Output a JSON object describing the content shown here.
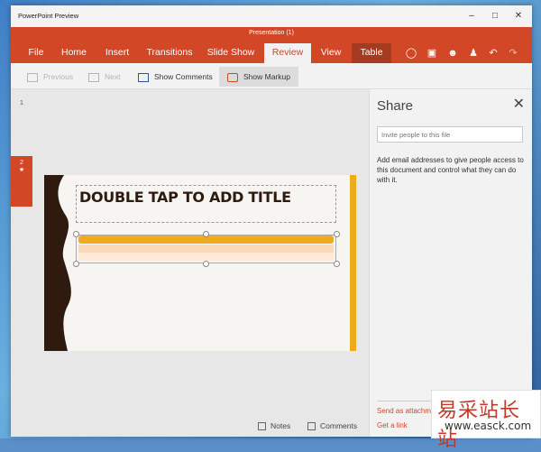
{
  "window": {
    "app_title": "PowerPoint Preview",
    "doc_title": "Presentation (1)"
  },
  "ribbon": {
    "tabs": [
      "File",
      "Home",
      "Insert",
      "Transitions",
      "Slide Show",
      "Review",
      "View",
      "Table"
    ],
    "active_tab": "Review",
    "accent_color": "#d24726"
  },
  "toolbar": {
    "previous": "Previous",
    "next": "Next",
    "show_comments": "Show Comments",
    "show_markup": "Show Markup"
  },
  "thumbnails": {
    "slide1_number": "1",
    "slide2_number": "2",
    "slide2_star": "★"
  },
  "slide": {
    "title_placeholder": "DOUBLE TAP TO ADD TITLE"
  },
  "status_bar": {
    "notes": "Notes",
    "comments": "Comments"
  },
  "share": {
    "title": "Share",
    "close": "✕",
    "invite_placeholder": "Invite people to this file",
    "description": "Add email addresses to give people access to this document and control what they can do with it.",
    "send_attachment": "Send as attachm",
    "get_link": "Get a link"
  },
  "watermark": {
    "chinese": "易采站长站",
    "url": "www.easck.com"
  }
}
